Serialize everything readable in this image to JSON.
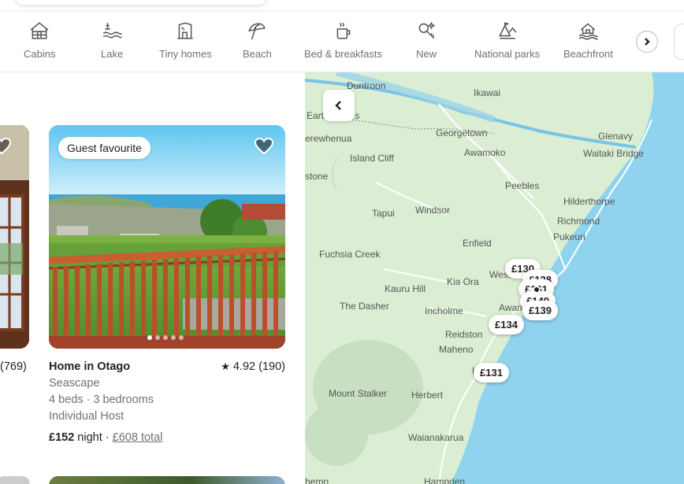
{
  "categories": [
    {
      "label": "Cabins",
      "icon": "cabin-icon"
    },
    {
      "label": "Lake",
      "icon": "lake-icon"
    },
    {
      "label": "Tiny homes",
      "icon": "tiny-home-icon"
    },
    {
      "label": "Beach",
      "icon": "beach-umbrella-icon"
    },
    {
      "label": "Bed & breakfasts",
      "icon": "coffee-icon"
    },
    {
      "label": "New",
      "icon": "new-key-icon"
    },
    {
      "label": "National parks",
      "icon": "national-park-icon"
    },
    {
      "label": "Beachfront",
      "icon": "beachfront-icon"
    }
  ],
  "left_listing": {
    "rating_partial": "(769)"
  },
  "listing": {
    "badge": "Guest favourite",
    "title": "Home in Otago",
    "rating": "4.92 (190)",
    "line1": "Seascape",
    "line2": "4 beds · 3 bedrooms",
    "line3": "Individual Host",
    "price": "£152",
    "price_unit": "night",
    "separator": "·",
    "total": "£608 total",
    "photo_count": 5,
    "photo_active": 0
  },
  "map": {
    "labels": [
      "Duntroon",
      "Ikawai",
      "Earthquakes",
      "Georgetown",
      "Glenavy",
      "erewhenua",
      "Awamoko",
      "Waitaki Bridge",
      "Island Cliff",
      "stone",
      "Peebles",
      "Hilderthorpe",
      "Tapui",
      "Windsor",
      "Richmond",
      "Pukeuri",
      "Enfield",
      "Fuchsia Creek",
      "Weston",
      "Kia Ora",
      "Kauru Hill",
      "The Dasher",
      "Incholme",
      "Awamoa",
      "Reidston",
      "Maheno",
      "Kakanui",
      "Mount Stalker",
      "Herbert",
      "Waianakarua",
      "Hampden",
      "hemo"
    ],
    "pins": [
      "£130",
      "£128",
      "£161",
      "£149",
      "£139",
      "£134",
      "£131"
    ]
  },
  "colors": {
    "land": "#dbeed3",
    "sea": "#8fd3ee",
    "river": "#78c3e6",
    "road": "#ffffff"
  }
}
